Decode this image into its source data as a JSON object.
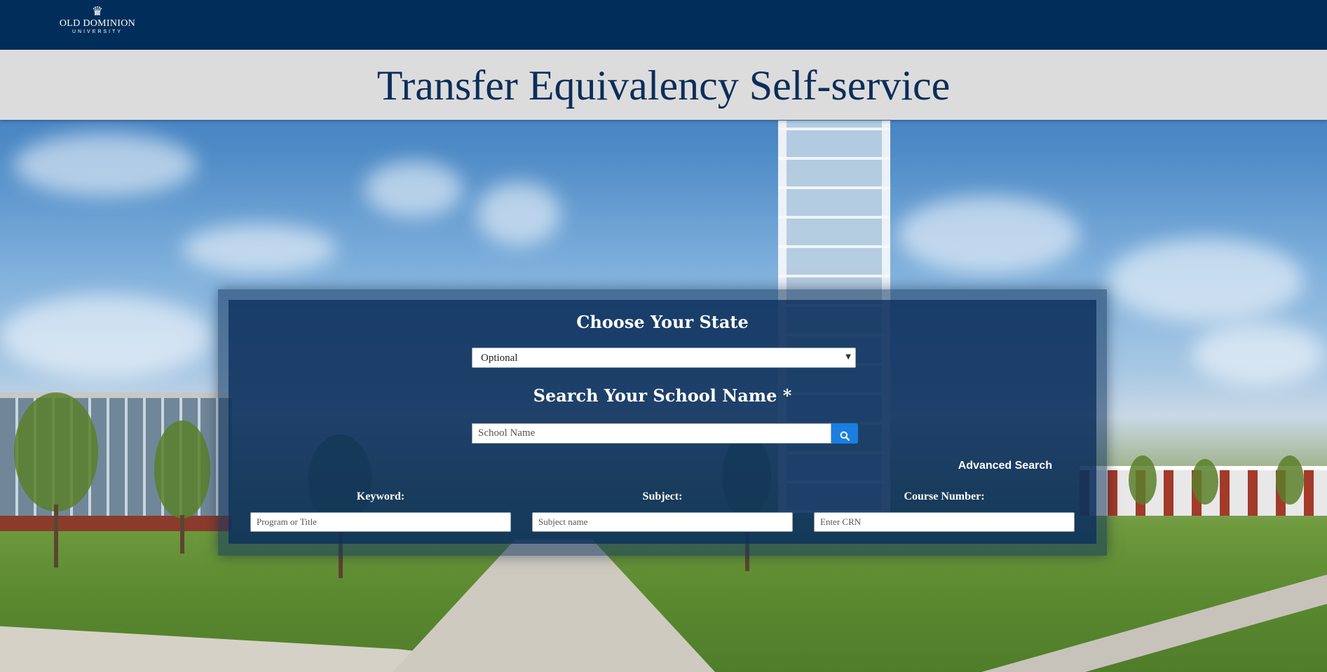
{
  "header": {
    "logo": {
      "icon": "crown-icon",
      "name": "OLD DOMINION",
      "subtitle": "UNIVERSITY"
    },
    "title": "Transfer Equivalency Self-service"
  },
  "search": {
    "state_heading": "Choose Your State",
    "state_select_value": "Optional",
    "school_heading": "Search Your School Name *",
    "school_placeholder": "School Name",
    "search_icon": "search-icon",
    "advanced_link": "Advanced Search",
    "fields": [
      {
        "label": "Keyword:",
        "placeholder": "Program or Title"
      },
      {
        "label": "Subject:",
        "placeholder": "Subject name"
      },
      {
        "label": "Course Number:",
        "placeholder": "Enter CRN"
      }
    ]
  },
  "colors": {
    "header_bg": "#012d5a",
    "title_bar_bg": "#dcdcdc",
    "title_text": "#0c2d5a",
    "panel_bg": "#0c305c",
    "search_button": "#1a7fe0"
  }
}
